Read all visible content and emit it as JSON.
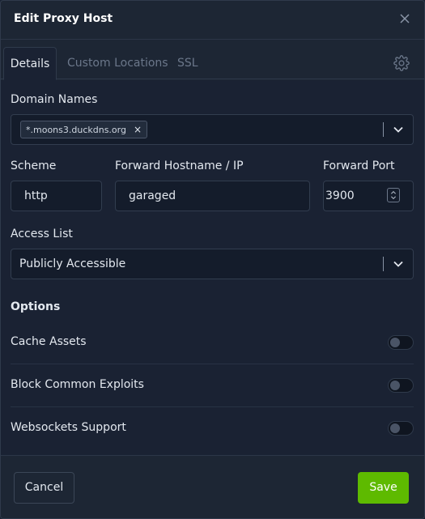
{
  "modal": {
    "title": "Edit Proxy Host",
    "tabs": [
      {
        "label": "Details"
      },
      {
        "label": "Custom Locations"
      },
      {
        "label": "SSL"
      }
    ]
  },
  "form": {
    "domain_names": {
      "label": "Domain Names",
      "chips": [
        "*.moons3.duckdns.org"
      ],
      "chip_remove": "×"
    },
    "scheme": {
      "label": "Scheme",
      "value": "http"
    },
    "forward_host": {
      "label": "Forward Hostname / IP",
      "value": "garaged"
    },
    "forward_port": {
      "label": "Forward Port",
      "value": "3900"
    },
    "access_list": {
      "label": "Access List",
      "value": "Publicly Accessible"
    }
  },
  "options": {
    "heading": "Options",
    "items": [
      {
        "label": "Cache Assets",
        "enabled": false
      },
      {
        "label": "Block Common Exploits",
        "enabled": false
      },
      {
        "label": "Websockets Support",
        "enabled": false
      }
    ]
  },
  "footer": {
    "cancel_label": "Cancel",
    "save_label": "Save"
  },
  "colors": {
    "accent": "#5eba00",
    "background": "#1a2233",
    "surface": "#1d2634"
  },
  "icons": {
    "close": "close-icon",
    "settings": "gear-icon",
    "chevron": "chevron-down-icon",
    "stepper": "stepper-icon"
  }
}
